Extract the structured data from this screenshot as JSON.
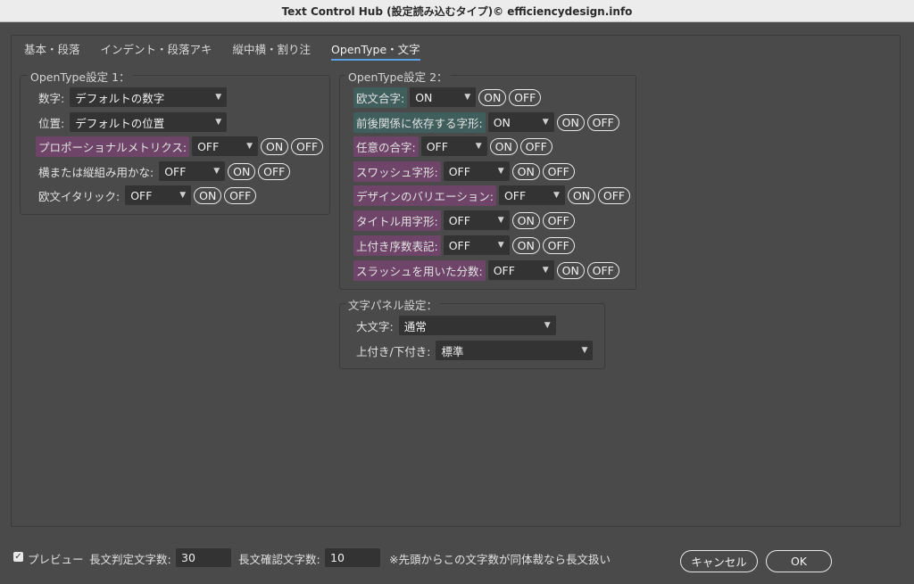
{
  "window": {
    "title": "Text Control Hub (設定読み込むタイプ)© efficiencydesign.info"
  },
  "tabs": [
    {
      "label": "基本・段落"
    },
    {
      "label": "インデント・段落アキ"
    },
    {
      "label": "縦中横・割り注"
    },
    {
      "label": "OpenType・文字",
      "active": true
    }
  ],
  "group1": {
    "title": "OpenType設定 1：",
    "rows": [
      {
        "label": "数字:",
        "value": "デフォルトの数字"
      },
      {
        "label": "位置:",
        "value": "デフォルトの位置"
      },
      {
        "label": "プロポーショナルメトリクス:",
        "value": "OFF",
        "on": "ON",
        "off": "OFF"
      },
      {
        "label": "横または縦組み用かな:",
        "value": "OFF",
        "on": "ON",
        "off": "OFF"
      },
      {
        "label": "欧文イタリック:",
        "value": "OFF",
        "on": "ON",
        "off": "OFF"
      }
    ]
  },
  "group2": {
    "title": "OpenType設定 2：",
    "rows": [
      {
        "label": "欧文合字:",
        "value": "ON",
        "on": "ON",
        "off": "OFF"
      },
      {
        "label": "前後関係に依存する字形:",
        "value": "ON",
        "on": "ON",
        "off": "OFF"
      },
      {
        "label": "任意の合字:",
        "value": "OFF",
        "on": "ON",
        "off": "OFF"
      },
      {
        "label": "スワッシュ字形:",
        "value": "OFF",
        "on": "ON",
        "off": "OFF"
      },
      {
        "label": "デザインのバリエーション:",
        "value": "OFF",
        "on": "ON",
        "off": "OFF"
      },
      {
        "label": "タイトル用字形:",
        "value": "OFF",
        "on": "ON",
        "off": "OFF"
      },
      {
        "label": "上付き序数表記:",
        "value": "OFF",
        "on": "ON",
        "off": "OFF"
      },
      {
        "label": "スラッシュを用いた分数:",
        "value": "OFF",
        "on": "ON",
        "off": "OFF"
      }
    ]
  },
  "group3": {
    "title": "文字パネル設定：",
    "rows": [
      {
        "label": "大文字:",
        "value": "通常"
      },
      {
        "label": "上付き/下付き:",
        "value": "標準"
      }
    ]
  },
  "footer": {
    "preview_label": "プレビュー",
    "long_judge_label": "長文判定文字数:",
    "long_judge_value": "30",
    "long_confirm_label": "長文確認文字数:",
    "long_confirm_value": "10",
    "note": "※先頭からこの文字数が同体裁なら長文扱い",
    "cancel_label": "キャンセル",
    "ok_label": "OK"
  },
  "colors": {
    "accent": "#5aa0e6",
    "label_purple": "#6e4468",
    "label_teal": "#3f5e5c",
    "background": "#4a4a4a"
  }
}
